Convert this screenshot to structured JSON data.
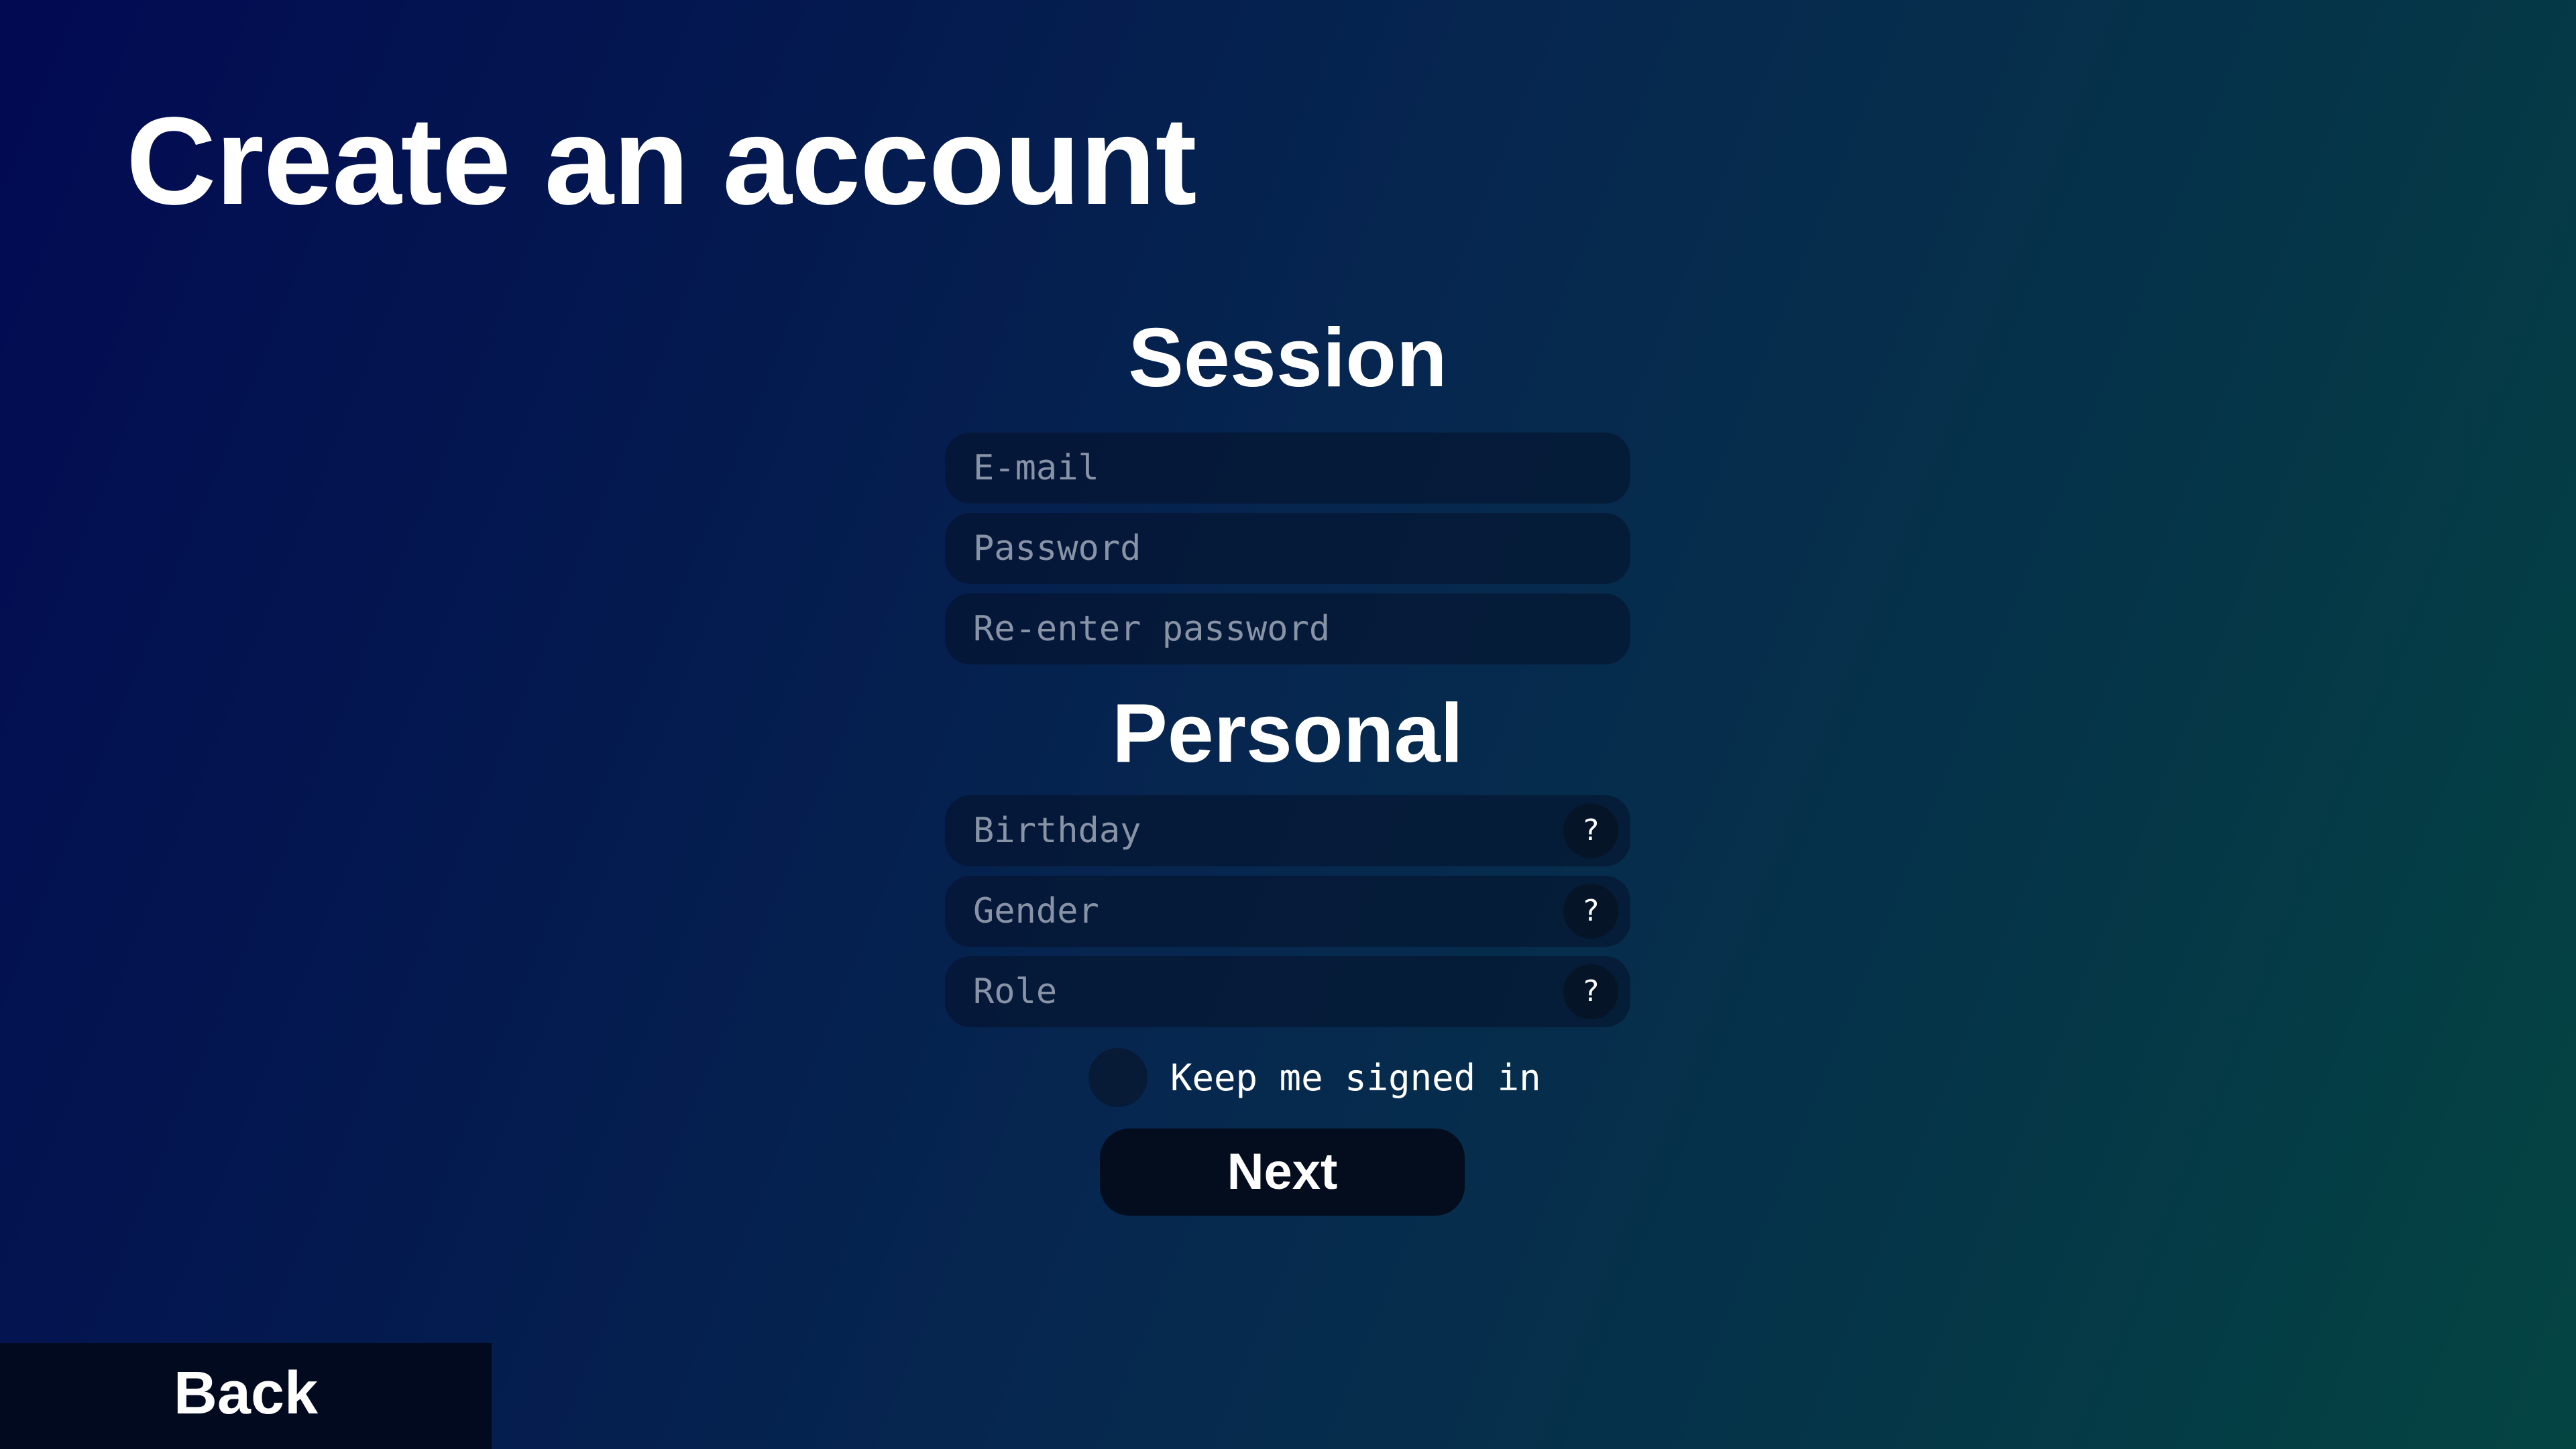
{
  "page": {
    "title": "Create an account"
  },
  "session": {
    "heading": "Session",
    "email_placeholder": "E-mail",
    "password_placeholder": "Password",
    "reenter_placeholder": "Re-enter password"
  },
  "personal": {
    "heading": "Personal",
    "birthday_placeholder": "Birthday",
    "gender_placeholder": "Gender",
    "role_placeholder": "Role",
    "help_label": "?"
  },
  "keep_signed_in": {
    "label": "Keep me signed in",
    "checked": false
  },
  "actions": {
    "next_label": "Next",
    "back_label": "Back"
  },
  "colors": {
    "gradient_start": "#020a52",
    "gradient_end": "#044542",
    "field_background": "#06142f",
    "button_background": "#030d1e",
    "text": "#ffffff",
    "placeholder": "#8893a6"
  },
  "icons": {
    "help": "question-mark-icon",
    "toggle": "circle-toggle-icon"
  }
}
